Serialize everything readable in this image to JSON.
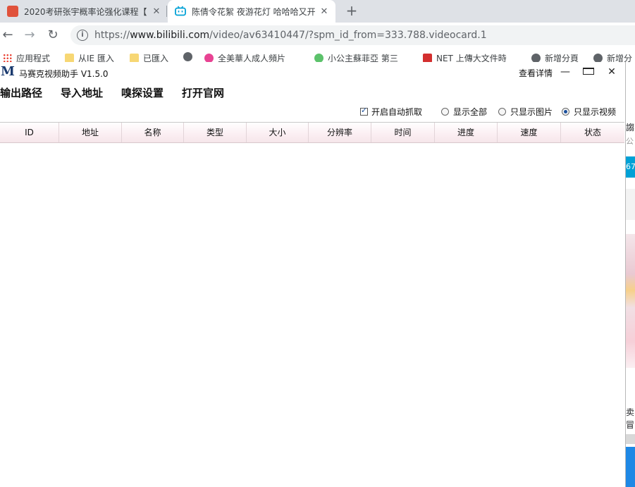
{
  "browser": {
    "tabs": [
      {
        "title": "2020考研张宇概率论强化课程【",
        "close": "✕",
        "active": false,
        "favicon_color": "#e0523b"
      },
      {
        "title": "陈倩令花絮 夜游花灯 哈哈哈又开",
        "close": "✕",
        "active": true,
        "favicon_color": "#00a1d6"
      }
    ],
    "new_tab": "+",
    "nav": {
      "back": "←",
      "forward": "→",
      "reload": "↻"
    },
    "url": {
      "scheme": "https://",
      "host": "www.bilibili.com",
      "path": "/video/av63410447/?spm_id_from=333.788.videocard.1"
    },
    "bookmarks": [
      {
        "label": "应用程式",
        "icon_color": "#ea4335"
      },
      {
        "label": "从IE 匯入",
        "icon_color": "#f7d774"
      },
      {
        "label": "已匯入",
        "icon_color": "#f7d774"
      },
      {
        "label": "",
        "icon_color": "#5f6368"
      },
      {
        "label": "全美華人成人頻片",
        "icon_color": "#e84393"
      },
      {
        "label": "小公主蘇菲亞 第三",
        "icon_color": "#5cc26b"
      },
      {
        "label": "NET 上傳大文件時",
        "icon_color": "#d32f2f"
      },
      {
        "label": "新增分頁",
        "icon_color": "#5f6368"
      },
      {
        "label": "新增分",
        "icon_color": "#5f6368"
      }
    ]
  },
  "app": {
    "logo": "M",
    "title": "马赛克视频助手 V1.5.0",
    "detail_button": "查看详情",
    "window_controls": {
      "minimize": "—",
      "close": "✕"
    },
    "menu": [
      "输出路径",
      "导入地址",
      "嗅探设置",
      "打开官网"
    ],
    "options": {
      "auto_capture": {
        "label": "开启自动抓取",
        "checked": true
      },
      "radios": [
        {
          "label": "显示全部",
          "selected": false
        },
        {
          "label": "只显示图片",
          "selected": false
        },
        {
          "label": "只显示视频",
          "selected": true
        }
      ]
    },
    "table": {
      "columns": [
        "ID",
        "地址",
        "名称",
        "类型",
        "大小",
        "分辨率",
        "时间",
        "进度",
        "速度",
        "状态"
      ],
      "rows": []
    }
  },
  "side_page": {
    "fragments": [
      "謅",
      "公",
      "67",
      "卖",
      "冒"
    ],
    "accent": "#00a1d6"
  }
}
